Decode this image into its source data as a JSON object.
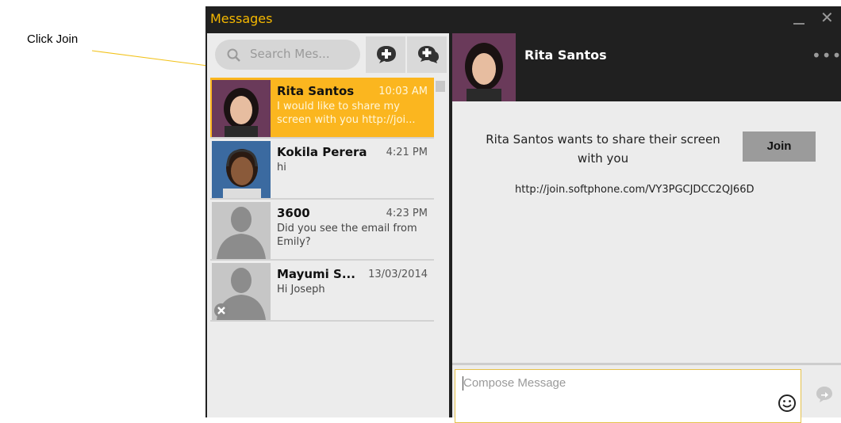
{
  "annotation": {
    "text": "Click Join"
  },
  "window": {
    "title": "Messages"
  },
  "search": {
    "placeholder": "Search Mes..."
  },
  "conversations": [
    {
      "name": "Rita Santos",
      "time": "10:03 AM",
      "preview": "I would like to share my screen with you http://joi...",
      "selected": true,
      "avatar": "photo-woman-short-hair"
    },
    {
      "name": "Kokila Perera",
      "time": "4:21 PM",
      "preview": "hi",
      "selected": false,
      "avatar": "photo-woman-headset"
    },
    {
      "name": "3600",
      "time": "4:23 PM",
      "preview": "Did you see the email from Emily?",
      "selected": false,
      "avatar": "default-silhouette"
    },
    {
      "name": "Mayumi S...",
      "time": "13/03/2014",
      "preview": "Hi Joseph",
      "selected": false,
      "avatar": "default-silhouette-offline"
    }
  ],
  "chat": {
    "contact_name": "Rita Santos",
    "share_message": "Rita Santos wants to share their screen with you",
    "join_label": "Join",
    "link": "http://join.softphone.com/VY3PGCJDCC2QJ66D",
    "compose_placeholder": "Compose Message"
  },
  "colors": {
    "accent": "#f5b800",
    "selected": "#fbb61f",
    "titlebar": "#202020"
  }
}
